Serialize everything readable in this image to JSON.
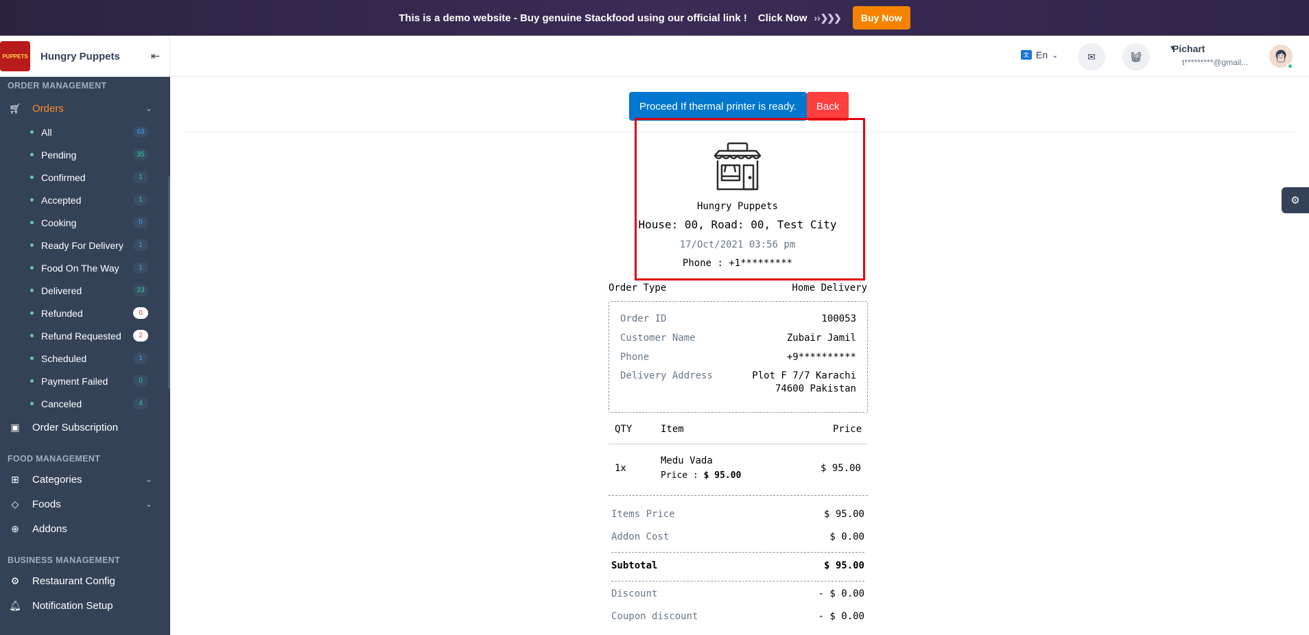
{
  "banner": {
    "text": "This is a demo website - Buy genuine Stackfood using our official link !",
    "link": "Click Now",
    "arrows": "› › ❯❯❯",
    "button": "Buy Now"
  },
  "sidebar": {
    "brand_name": "Hungry Puppets",
    "logo_text": "PUPPETS",
    "sections": {
      "order": "ORDER MANAGEMENT",
      "food": "FOOD MANAGEMENT",
      "business": "BUSINESS MANAGEMENT"
    },
    "orders_label": "Orders",
    "order_items": [
      {
        "label": "All",
        "count": "63"
      },
      {
        "label": "Pending",
        "count": "35"
      },
      {
        "label": "Confirmed",
        "count": "1"
      },
      {
        "label": "Accepted",
        "count": "1"
      },
      {
        "label": "Cooking",
        "count": "0"
      },
      {
        "label": "Ready For Delivery",
        "count": "1"
      },
      {
        "label": "Food On The Way",
        "count": "1"
      },
      {
        "label": "Delivered",
        "count": "23"
      },
      {
        "label": "Refunded",
        "count": "0"
      },
      {
        "label": "Refund Requested",
        "count": "2"
      },
      {
        "label": "Scheduled",
        "count": "1"
      },
      {
        "label": "Payment Failed",
        "count": "0"
      },
      {
        "label": "Canceled",
        "count": "4"
      }
    ],
    "order_subscription": "Order Subscription",
    "categories": "Categories",
    "foods": "Foods",
    "addons": "Addons",
    "restaurant_config": "Restaurant Config",
    "notification_setup": "Notification Setup"
  },
  "header": {
    "lang": "En",
    "user_name": "Pichart",
    "user_email": "t*********@gmail..."
  },
  "actions": {
    "proceed": "Proceed If thermal printer is ready.",
    "back": "Back"
  },
  "receipt": {
    "restaurant": "Hungry Puppets",
    "address": "House: 00, Road: 00, Test City",
    "date": "17/Oct/2021 03:56 pm",
    "phone": "Phone : +1*********",
    "order_type_label": "Order Type",
    "order_type_value": "Home Delivery",
    "info": {
      "order_id_label": "Order ID",
      "order_id": "100053",
      "customer_label": "Customer Name",
      "customer": "Zubair Jamil",
      "phone_label": "Phone",
      "phone": "+9**********",
      "address_label": "Delivery Address",
      "address_line1": "Plot F 7/7 Karachi",
      "address_line2": "74600 Pakistan"
    },
    "table_headers": {
      "qty": "QTY",
      "item": "Item",
      "price": "Price"
    },
    "item": {
      "qty": "1x",
      "name": "Medu Vada",
      "price_label": "Price :",
      "unit_price": "$ 95.00",
      "total": "$ 95.00"
    },
    "summary": {
      "items_price_label": "Items Price",
      "items_price": "$ 95.00",
      "addon_label": "Addon Cost",
      "addon": "$ 0.00",
      "subtotal_label": "Subtotal",
      "subtotal": "$ 95.00",
      "discount_label": "Discount",
      "discount": "- $ 0.00",
      "coupon_label": "Coupon discount",
      "coupon": "- $ 0.00"
    }
  },
  "colors": {
    "sidebar": "#334257",
    "accent_orange": "#ff8e2b",
    "proceed_blue": "#0177cd",
    "back_red": "#ff3e3e",
    "highlight_red": "#e0000f"
  }
}
